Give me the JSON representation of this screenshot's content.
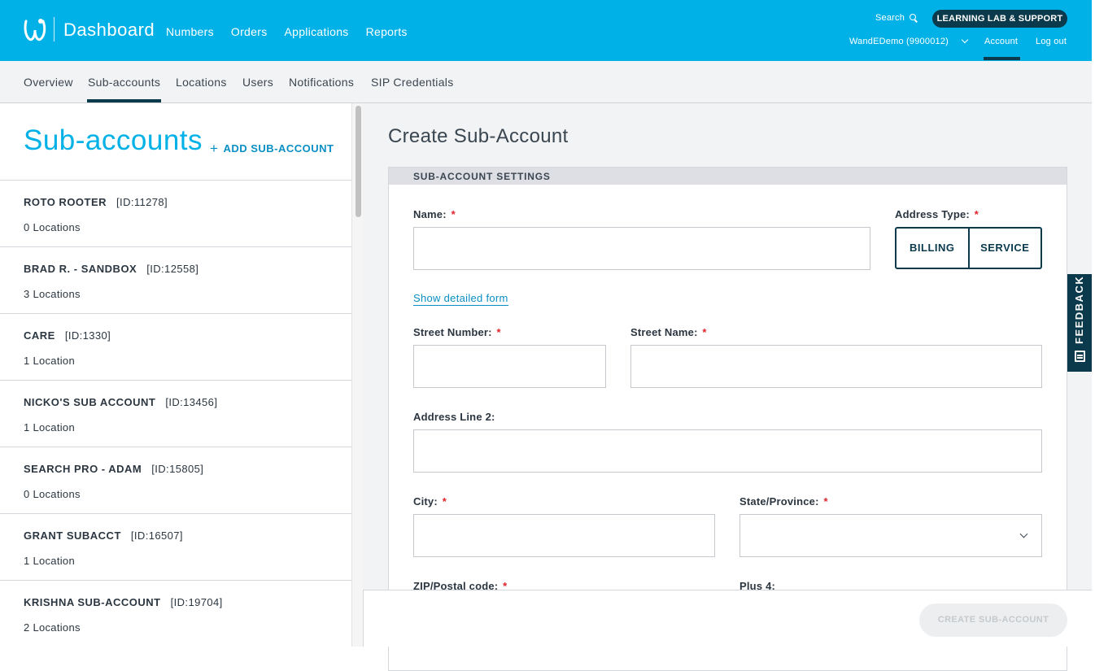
{
  "colors": {
    "brand": "#00b1e7",
    "dark": "#0b3a4c",
    "link": "#0a8fc4",
    "required": "#e0242b"
  },
  "header": {
    "app_title": "Dashboard",
    "nav": [
      "Numbers",
      "Orders",
      "Applications",
      "Reports"
    ],
    "search_label": "Search",
    "learning_lab_label": "LEARNING LAB & SUPPORT",
    "account_selector": "WandEDemo (9900012)",
    "account_link": "Account",
    "logout": "Log out"
  },
  "subnav": {
    "tabs": [
      "Overview",
      "Sub-accounts",
      "Locations",
      "Users",
      "Notifications",
      "SIP Credentials"
    ],
    "active": "Sub-accounts"
  },
  "sidebar": {
    "title": "Sub-accounts",
    "add_label": "ADD SUB-ACCOUNT",
    "accounts": [
      {
        "name": "ROTO ROOTER",
        "id": "[ID:11278]",
        "locations": "0 Locations"
      },
      {
        "name": "BRAD R. - SANDBOX",
        "id": "[ID:12558]",
        "locations": "3 Locations"
      },
      {
        "name": "CARE",
        "id": "[ID:1330]",
        "locations": "1 Location"
      },
      {
        "name": "NICKO'S SUB ACCOUNT",
        "id": "[ID:13456]",
        "locations": "1 Location"
      },
      {
        "name": "SEARCH PRO - ADAM",
        "id": "[ID:15805]",
        "locations": "0 Locations"
      },
      {
        "name": "GRANT SUBACCT",
        "id": "[ID:16507]",
        "locations": "1 Location"
      },
      {
        "name": "KRISHNA SUB-ACCOUNT",
        "id": "[ID:19704]",
        "locations": "2 Locations"
      }
    ]
  },
  "form": {
    "page_title": "Create Sub-Account",
    "section_title": "SUB-ACCOUNT SETTINGS",
    "name_label": "Name:",
    "address_type_label": "Address Type:",
    "address_type_options": [
      "BILLING",
      "SERVICE"
    ],
    "detail_link": "Show detailed form",
    "street_number_label": "Street Number:",
    "street_name_label": "Street Name:",
    "address_line2_label": "Address Line 2:",
    "city_label": "City:",
    "state_label": "State/Province:",
    "zip_label": "ZIP/Postal code:",
    "plus4_label": "Plus 4:",
    "required_mark": "*",
    "submit_label": "CREATE SUB-ACCOUNT"
  },
  "feedback": {
    "label": "FEEDBACK"
  }
}
